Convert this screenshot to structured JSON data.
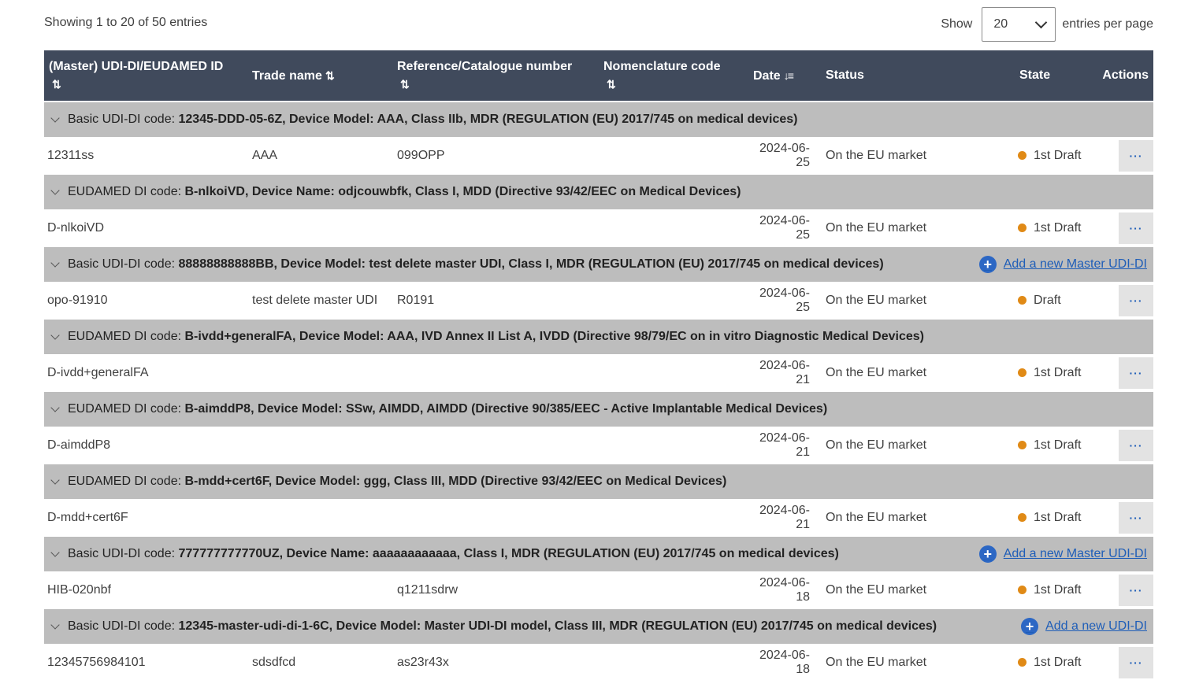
{
  "summary": "Showing 1 to 20 of 50 entries",
  "page_size": {
    "label_before": "Show",
    "value": "20",
    "label_after": "entries per page"
  },
  "columns": [
    {
      "label": "(Master) UDI-DI/EUDAMED ID",
      "sort": "⇅"
    },
    {
      "label": "Trade name",
      "sort": "⇅"
    },
    {
      "label": "Reference/Catalogue number",
      "sort": "⇅"
    },
    {
      "label": "Nomenclature code",
      "sort": "⇅"
    },
    {
      "label": "Date",
      "sort": "↓≡"
    },
    {
      "label": "Status",
      "sort": ""
    },
    {
      "label": "State",
      "sort": ""
    },
    {
      "label": "Actions",
      "sort": ""
    }
  ],
  "groups": [
    {
      "label": "Basic UDI-DI code:",
      "value": "12345-DDD-05-6Z, Device Model: AAA,   Class IIb,   MDR (REGULATION (EU) 2017/745 on medical devices)",
      "action": "",
      "row": {
        "id": "12311ss",
        "trade": "AAA",
        "ref": "099OPP",
        "nom": "",
        "date": "2024-06-25",
        "status": "On the EU market",
        "state": "1st  Draft",
        "actions": "···"
      }
    },
    {
      "label": "EUDAMED DI code:",
      "value": "B-nlkoiVD, Device Name: odjcouwbfk,   Class I,   MDD (Directive 93/42/EEC on Medical Devices)",
      "action": "",
      "row": {
        "id": "D-nlkoiVD",
        "trade": "",
        "ref": "",
        "nom": "",
        "date": "2024-06-25",
        "status": "On the EU market",
        "state": "1st  Draft",
        "actions": "···"
      }
    },
    {
      "label": "Basic UDI-DI code:",
      "value": "88888888888BB, Device Model: test delete master UDI,   Class I,   MDR (REGULATION (EU) 2017/745 on medical devices)",
      "action": "Add a new Master UDI-DI",
      "row": {
        "id": "opo-91910",
        "trade": "test delete master UDI",
        "ref": "R0191",
        "nom": "",
        "date": "2024-06-25",
        "status": "On the EU market",
        "state": "Draft",
        "actions": "···"
      }
    },
    {
      "label": "EUDAMED DI code:",
      "value": "B-ivdd+generalFA, Device Model: AAA,   IVD Annex II List A,   IVDD (Directive 98/79/EC on in vitro Diagnostic Medical Devices)",
      "action": "",
      "row": {
        "id": "D-ivdd+generalFA",
        "trade": "",
        "ref": "",
        "nom": "",
        "date": "2024-06-21",
        "status": "On the EU market",
        "state": "1st  Draft",
        "actions": "···"
      }
    },
    {
      "label": "EUDAMED DI code:",
      "value": "B-aimddP8, Device Model: SSw,   AIMDD,   AIMDD (Directive 90/385/EEC - Active Implantable Medical Devices)",
      "action": "",
      "row": {
        "id": "D-aimddP8",
        "trade": "",
        "ref": "",
        "nom": "",
        "date": "2024-06-21",
        "status": "On the EU market",
        "state": "1st  Draft",
        "actions": "···"
      }
    },
    {
      "label": "EUDAMED DI code:",
      "value": "B-mdd+cert6F, Device Model: ggg,   Class III,   MDD (Directive 93/42/EEC on Medical Devices)",
      "action": "",
      "row": {
        "id": "D-mdd+cert6F",
        "trade": "",
        "ref": "",
        "nom": "",
        "date": "2024-06-21",
        "status": "On the EU market",
        "state": "1st  Draft",
        "actions": "···"
      }
    },
    {
      "label": "Basic UDI-DI code:",
      "value": "777777777770UZ, Device Name: aaaaaaaaaaaa,   Class I,   MDR (REGULATION (EU) 2017/745 on medical devices)",
      "action": "Add a new Master UDI-DI",
      "row": {
        "id": "HIB-020nbf",
        "trade": "",
        "ref": "q1211sdrw",
        "nom": "",
        "date": "2024-06-18",
        "status": "On the EU market",
        "state": "1st  Draft",
        "actions": "···"
      }
    },
    {
      "label": "Basic UDI-DI code:",
      "value": "12345-master-udi-di-1-6C, Device Model: Master UDI-DI model,   Class III,   MDR (REGULATION (EU) 2017/745 on medical devices)",
      "action": "Add a new UDI-DI",
      "row": {
        "id": "12345756984101",
        "trade": "sdsdfcd",
        "ref": "as23r43x",
        "nom": "",
        "date": "2024-06-18",
        "status": "On the EU market",
        "state": "1st  Draft",
        "actions": "···"
      }
    }
  ],
  "colors": {
    "header_bg": "#404a5c",
    "group_bg": "#bdbdbd",
    "link": "#1f5eb8",
    "state_dot": "#e08a16",
    "action_btn_bg": "#e3e3e3"
  }
}
